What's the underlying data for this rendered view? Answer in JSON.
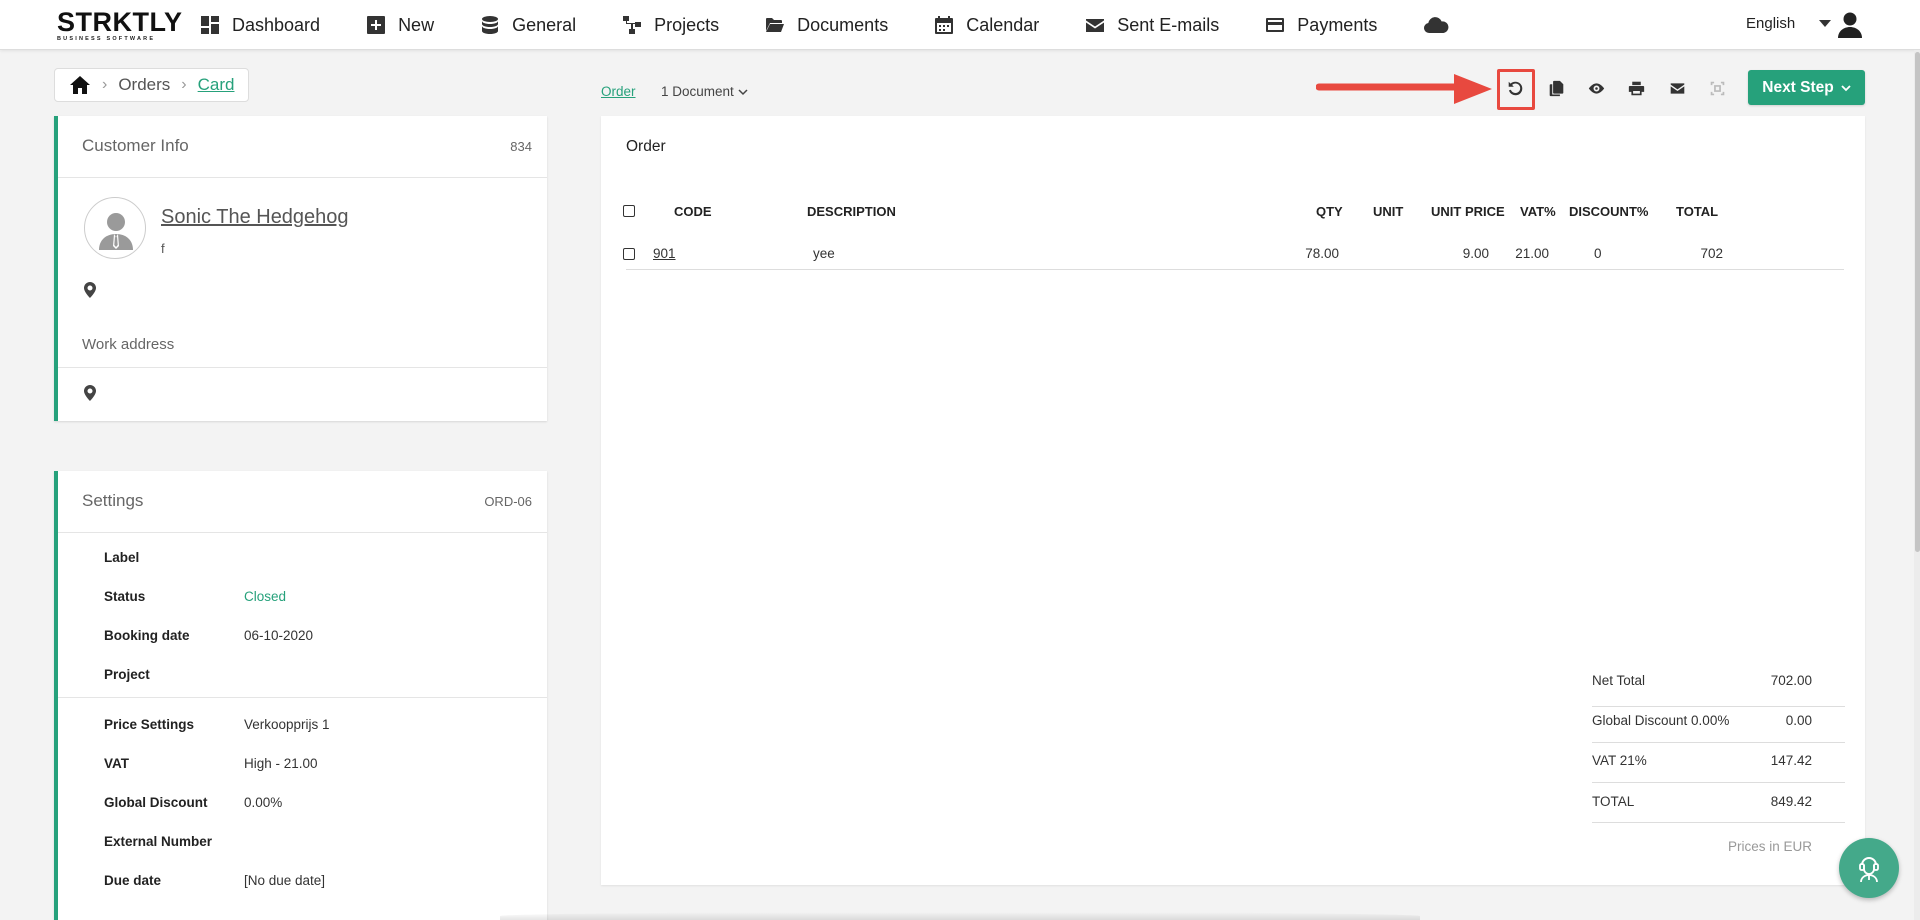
{
  "app": {
    "logo_main": "STRKTLY",
    "logo_sub": "BUSINESS SOFTWARE",
    "accent_color": "#26a17b"
  },
  "nav": {
    "items": [
      {
        "label": "Dashboard",
        "icon": "dashboard-icon"
      },
      {
        "label": "New",
        "icon": "plus-square-icon"
      },
      {
        "label": "General",
        "icon": "database-icon"
      },
      {
        "label": "Projects",
        "icon": "sitemap-icon"
      },
      {
        "label": "Documents",
        "icon": "folder-open-icon"
      },
      {
        "label": "Calendar",
        "icon": "calendar-icon"
      },
      {
        "label": "Sent E-mails",
        "icon": "envelope-icon"
      },
      {
        "label": "Payments",
        "icon": "credit-card-icon"
      }
    ],
    "cloud_icon": "cloud-icon",
    "language": "English",
    "user_icon": "user-icon"
  },
  "breadcrumb": {
    "home_icon": "home-icon",
    "orders": "Orders",
    "card": "Card"
  },
  "customer": {
    "title": "Customer Info",
    "number": "834",
    "name": "Sonic The Hedgehog",
    "sub": "f",
    "work_address_label": "Work address"
  },
  "settings": {
    "title": "Settings",
    "code": "ORD-06",
    "rows": [
      {
        "label": "Label",
        "value": ""
      },
      {
        "label": "Status",
        "value": "Closed"
      },
      {
        "label": "Booking date",
        "value": "06-10-2020"
      },
      {
        "label": "Project",
        "value": ""
      },
      {
        "label": "Price Settings",
        "value": "Verkoopprijs 1"
      },
      {
        "label": "VAT",
        "value": "High - 21.00"
      },
      {
        "label": "Global Discount",
        "value": "0.00%"
      },
      {
        "label": "External Number",
        "value": ""
      },
      {
        "label": "Due date",
        "value": "[No due date]"
      }
    ]
  },
  "document": {
    "type_link": "Order",
    "count": "1 Document",
    "title": "Order",
    "next_step": "Next Step",
    "toolbar": [
      "undo-icon",
      "copy-icon",
      "eye-icon",
      "print-icon",
      "envelope-icon",
      "crop-icon"
    ],
    "columns": [
      "CODE",
      "DESCRIPTION",
      "QTY",
      "UNIT",
      "UNIT PRICE",
      "VAT%",
      "DISCOUNT%",
      "TOTAL"
    ],
    "rows": [
      {
        "code": "901",
        "description": "yee",
        "qty": "78.00",
        "unit": "",
        "unit_price": "9.00",
        "vat": "21.00",
        "discount": "0",
        "total": "702"
      }
    ],
    "totals": [
      {
        "label": "Net Total",
        "value": "702.00"
      },
      {
        "label": "Global Discount 0.00%",
        "value": "0.00"
      },
      {
        "label": "VAT 21%",
        "value": "147.42"
      },
      {
        "label": "TOTAL",
        "value": "849.42"
      }
    ],
    "prices_note": "Prices in EUR"
  }
}
